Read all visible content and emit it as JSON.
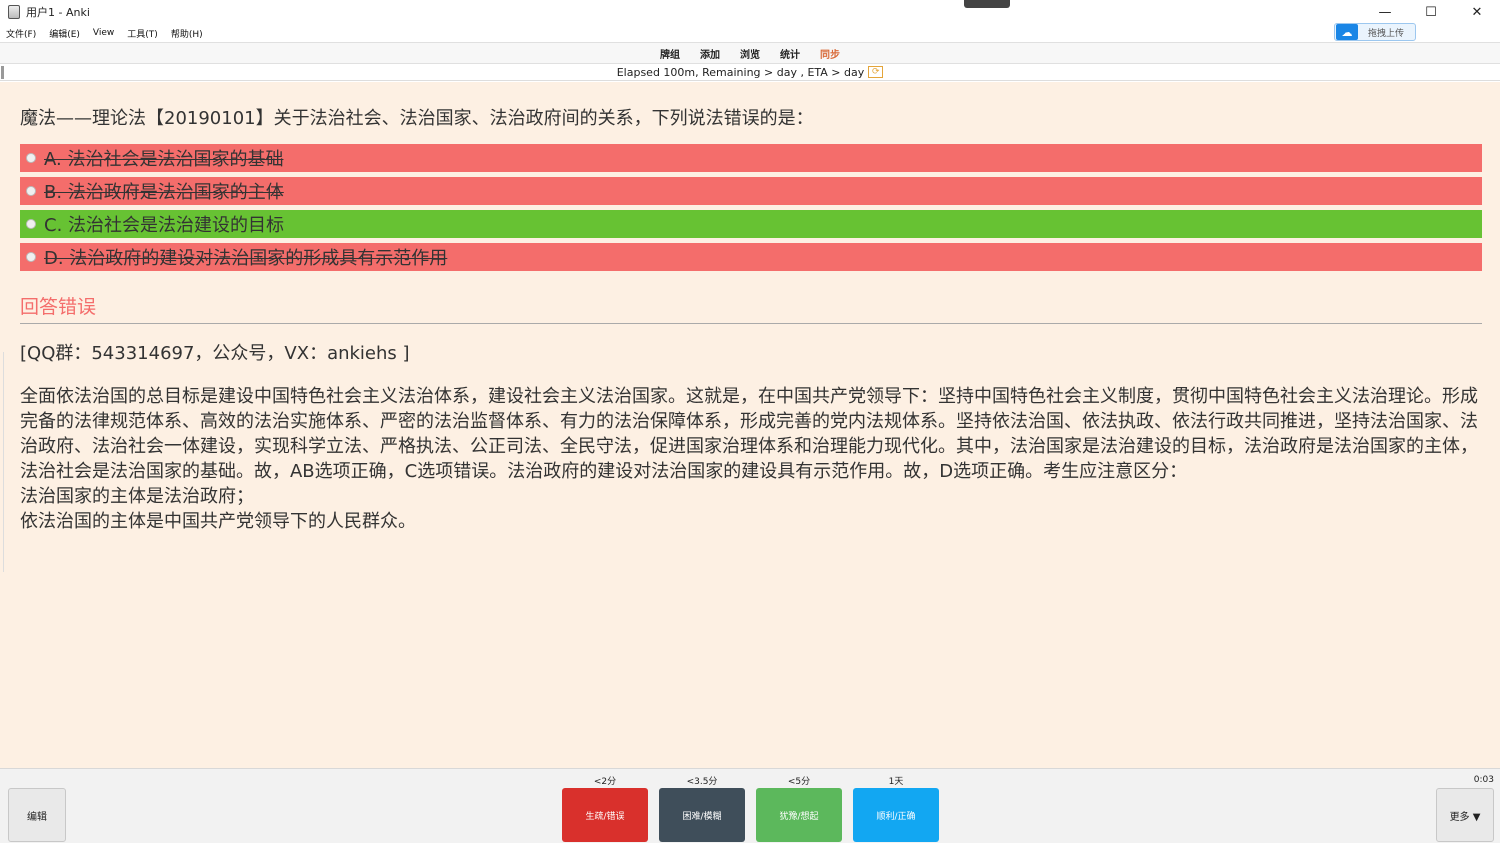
{
  "window": {
    "title": "用户1 - Anki",
    "controls": [
      "—",
      "☐",
      "✕"
    ]
  },
  "menu": [
    "文件(F)",
    "编辑(E)",
    "View",
    "工具(T)",
    "帮助(H)"
  ],
  "upload": {
    "label": "拖拽上传"
  },
  "toolbar": {
    "items": [
      "牌组",
      "添加",
      "浏览",
      "统计",
      "同步"
    ]
  },
  "progress": {
    "text": "Elapsed 100m, Remaining > day , ETA > day"
  },
  "card": {
    "question": "魔法——理论法【20190101】关于法治社会、法治国家、法治政府间的关系，下列说法错误的是：",
    "options": [
      {
        "text": "A. 法治社会是法治国家的基础",
        "state": "wrong"
      },
      {
        "text": "B. 法治政府是法治国家的主体",
        "state": "wrong"
      },
      {
        "text": "C. 法治社会是法治建设的目标",
        "state": "right"
      },
      {
        "text": "D. 法治政府的建设对法治国家的形成具有示范作用",
        "state": "wrong"
      }
    ],
    "verdict": "回答错误",
    "qq": "[QQ群：543314697，公众号，VX：ankiehs ]",
    "explanation": [
      "全面依法治国的总目标是建设中国特色社会主义法治体系，建设社会主义法治国家。这就是，在中国共产党领导下：坚持中国特色社会主义制度，贯彻中国特色社会主义法治理论。形成完备的法律规范体系、高效的法治实施体系、严密的法治监督体系、有力的法治保障体系，形成完善的党内法规体系。坚持依法治国、依法执政、依法行政共同推进，坚持法治国家、法治政府、法治社会一体建设，实现科学立法、严格执法、公正司法、全民守法，促进国家治理体系和治理能力现代化。其中，法治国家是法治建设的目标，法治政府是法治国家的主体，法治社会是法治国家的基础。故，AB选项正确，C选项错误。法治政府的建设对法治国家的建设具有示范作用。故，D选项正确。考生应注意区分：",
      "法治国家的主体是法治政府；",
      "依法治国的主体是中国共产党领导下的人民群众。"
    ]
  },
  "bottom": {
    "edit_label": "编辑",
    "more_label": "更多 ▼",
    "timer": "0:03",
    "ease": [
      {
        "time": "<2分",
        "label": "生疏/错误",
        "color": "#d9302c"
      },
      {
        "time": "<3.5分",
        "label": "困难/模糊",
        "color": "#3f4e5a"
      },
      {
        "time": "<5分",
        "label": "犹豫/想起",
        "color": "#5cb85c"
      },
      {
        "time": "1天",
        "label": "顺利/正确",
        "color": "#12a7f2"
      }
    ]
  }
}
